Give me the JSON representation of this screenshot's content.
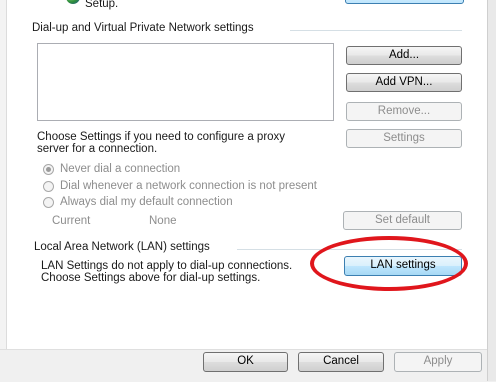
{
  "top": {
    "setup_text": "Setup."
  },
  "dialup": {
    "group_title": "Dial-up and Virtual Private Network settings",
    "buttons": {
      "add": "Add...",
      "add_vpn": "Add VPN...",
      "remove": "Remove...",
      "settings": "Settings",
      "set_default": "Set default"
    },
    "proxy_text_line1": "Choose Settings if you need to configure a proxy",
    "proxy_text_line2": "server for a connection.",
    "radios": [
      {
        "label": "Never dial a connection",
        "checked": true
      },
      {
        "label": "Dial whenever a network connection is not present",
        "checked": false
      },
      {
        "label": "Always dial my default connection",
        "checked": false
      }
    ],
    "current_label": "Current",
    "current_value": "None"
  },
  "lan": {
    "group_title": "Local Area Network (LAN) settings",
    "text_line1": "LAN Settings do not apply to dial-up connections.",
    "text_line2": "Choose Settings above for dial-up settings.",
    "button": "LAN settings",
    "highlight_color": "#e0161c"
  },
  "footer": {
    "ok": "OK",
    "cancel": "Cancel",
    "apply": "Apply"
  }
}
